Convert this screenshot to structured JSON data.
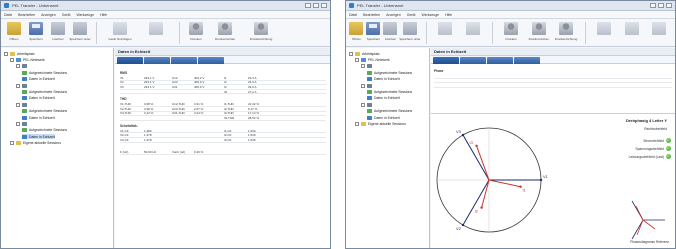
{
  "left": {
    "title": "PEL Transfer - Unbenannt",
    "menu": [
      "Datei",
      "Bearbeiten",
      "Anzeigen",
      "Gerät",
      "Werkzeuge",
      "Hilfe"
    ],
    "toolbar": [
      {
        "label": "Öffnen",
        "icon": "folder-icon"
      },
      {
        "label": "Speichern",
        "icon": "save-icon"
      },
      {
        "label": "Löschen",
        "icon": "delete-icon"
      },
      {
        "label": "Speichern unter",
        "icon": "save-as-icon"
      },
      {
        "label": "Gerät hinzufügen",
        "icon": "add-device-icon"
      },
      {
        "label": "",
        "icon": "device-icon"
      },
      {
        "label": "Drucken",
        "icon": "print-icon"
      },
      {
        "label": "Druckvorschau",
        "icon": "print-preview-icon"
      },
      {
        "label": "Druckeinrichtung",
        "icon": "print-setup-icon"
      }
    ],
    "tree": [
      {
        "label": "Arbeitsplatz",
        "icon": "folder-icon",
        "level": 0,
        "selected": false
      },
      {
        "label": "PEL-Netzwerk",
        "icon": "network-icon",
        "level": 1,
        "selected": false
      },
      {
        "label": "",
        "icon": "device-icon",
        "level": 2,
        "selected": false
      },
      {
        "label": "Aufgezeichnete Sessions",
        "icon": "session-icon",
        "level": 3,
        "selected": false
      },
      {
        "label": "Daten in Echtzeit",
        "icon": "live-icon",
        "level": 3,
        "selected": false
      },
      {
        "label": "",
        "icon": "device-icon",
        "level": 2,
        "selected": false
      },
      {
        "label": "Aufgezeichnete Sessions",
        "icon": "session-icon",
        "level": 3,
        "selected": false
      },
      {
        "label": "Daten in Echtzeit",
        "icon": "live-icon",
        "level": 3,
        "selected": false
      },
      {
        "label": "",
        "icon": "device-icon",
        "level": 2,
        "selected": false
      },
      {
        "label": "Aufgezeichnete Sessions",
        "icon": "session-icon",
        "level": 3,
        "selected": false
      },
      {
        "label": "Daten in Echtzeit",
        "icon": "live-icon",
        "level": 3,
        "selected": false
      },
      {
        "label": "",
        "icon": "device-icon",
        "level": 2,
        "selected": false
      },
      {
        "label": "Aufgezeichnete Sessions",
        "icon": "session-icon",
        "level": 3,
        "selected": false
      },
      {
        "label": "Daten in Echtzeit",
        "icon": "live-icon",
        "level": 3,
        "selected": true
      },
      {
        "label": "Eigene aktuelle Sessions",
        "icon": "folder-icon",
        "level": 1,
        "selected": false
      }
    ],
    "main_title": "Daten in Echtzeit",
    "tabs": [
      "",
      "",
      "",
      ""
    ],
    "sections": [
      {
        "name": "RMS",
        "rows": [
          [
            "V1",
            "233,1 V",
            "U12",
            "404,2 V",
            "I1",
            "23,3 A"
          ],
          [
            "V2",
            "233,1 V",
            "U23",
            "406,0 V",
            "I2",
            "23,3 A"
          ],
          [
            "V3",
            "233,1 V",
            "U31",
            "405,9 V",
            "I3",
            "33,0 A"
          ],
          [
            "",
            "",
            "",
            "",
            "IN",
            "27,2 A"
          ]
        ]
      },
      {
        "name": "THD",
        "rows": [
          [
            "V1-THD",
            "3,08 %",
            "U12-THD",
            "3,31 %",
            "I1-THD",
            "21,32 %"
          ],
          [
            "V2-THD",
            "3,38 %",
            "U23-THD",
            "2,07 %",
            "I2-THD",
            "6,17 %"
          ],
          [
            "V3-THD",
            "3,12 %",
            "U31-THD",
            "3,24 %",
            "I3-THD",
            "17,14 %"
          ],
          [
            "",
            "",
            "",
            "",
            "IN-THD",
            "28,52 %"
          ]
        ]
      },
      {
        "name": "Scheitelfak.",
        "rows": [
          [
            "V1-CF",
            "1,383",
            "",
            "",
            "I1-CF",
            "1,534"
          ],
          [
            "V2-CF",
            "1,378",
            "",
            "",
            "I2-CF",
            "1,533"
          ],
          [
            "V3-CF",
            "1,378",
            "",
            "",
            "I3-CF",
            "1,535"
          ]
        ]
      },
      {
        "name": "",
        "rows": [
          [
            "F (Hz)",
            "50,00 Hz",
            "Vunb (u2)",
            "0,40 %",
            "",
            ""
          ]
        ]
      }
    ]
  },
  "right": {
    "title": "PEL Transfer - Unbenannt",
    "menu": [
      "Datei",
      "Bearbeiten",
      "Anzeigen",
      "Gerät",
      "Werkzeuge",
      "Hilfe"
    ],
    "toolbar": [
      {
        "label": "Öffnen",
        "icon": "folder-icon"
      },
      {
        "label": "Speichern",
        "icon": "save-icon"
      },
      {
        "label": "Löschen",
        "icon": "delete-icon"
      },
      {
        "label": "Speichern unter",
        "icon": "save-as-icon"
      },
      {
        "label": "",
        "icon": "add-device-icon"
      },
      {
        "label": "",
        "icon": "device-icon"
      },
      {
        "label": "Drucken",
        "icon": "print-icon"
      },
      {
        "label": "Druckvorschau",
        "icon": "print-preview-icon"
      },
      {
        "label": "Druckeinrichtung",
        "icon": "print-setup-icon"
      },
      {
        "label": "",
        "icon": "gray-icon"
      },
      {
        "label": "",
        "icon": "gray-icon"
      },
      {
        "label": "",
        "icon": "gray-icon"
      }
    ],
    "tree": [
      {
        "label": "Arbeitsplatz",
        "icon": "folder-icon",
        "level": 0,
        "selected": false
      },
      {
        "label": "PEL-Netzwerk",
        "icon": "network-icon",
        "level": 1,
        "selected": false
      },
      {
        "label": "",
        "icon": "device-icon",
        "level": 2,
        "selected": false
      },
      {
        "label": "Aufgezeichnete Sessions",
        "icon": "session-icon",
        "level": 3,
        "selected": false
      },
      {
        "label": "Daten in Echtzeit",
        "icon": "live-icon",
        "level": 3,
        "selected": false
      },
      {
        "label": "",
        "icon": "device-icon",
        "level": 2,
        "selected": false
      },
      {
        "label": "Aufgezeichnete Sessions",
        "icon": "session-icon",
        "level": 3,
        "selected": false
      },
      {
        "label": "Daten in Echtzeit",
        "icon": "live-icon",
        "level": 3,
        "selected": false
      },
      {
        "label": "",
        "icon": "device-icon",
        "level": 2,
        "selected": false
      },
      {
        "label": "Aufgezeichnete Sessions",
        "icon": "session-icon",
        "level": 3,
        "selected": false
      },
      {
        "label": "Daten in Echtzeit",
        "icon": "live-icon",
        "level": 3,
        "selected": false
      },
      {
        "label": "Eigene aktuelle Sessions",
        "icon": "folder-icon",
        "level": 1,
        "selected": false
      }
    ],
    "main_title": "Daten in Echtzeit",
    "tabs": [
      "",
      "",
      "",
      ""
    ],
    "section_name": "Phase",
    "rows": [
      [
        "",
        "",
        "",
        "",
        "",
        "",
        "",
        ""
      ],
      [
        "",
        "",
        "",
        "",
        "",
        "",
        "",
        ""
      ],
      [
        "",
        "",
        "",
        "",
        "",
        "",
        "",
        ""
      ]
    ],
    "panel_title": "Drehphasig 4 Leiter Y",
    "panel_sub": "Rechtsdrehfeld",
    "status": [
      {
        "label": "Stromdrehfeld",
        "color": "#2f9a2a"
      },
      {
        "label": "Spannungsdrehfeld",
        "color": "#2f9a2a"
      },
      {
        "label": "Leistungsdrehfeld (Last)",
        "color": "#2f9a2a"
      }
    ],
    "phasors": [
      {
        "label": "V1",
        "angle_deg": 0,
        "magnitude": 1.0,
        "color": "#1f2a6b"
      },
      {
        "label": "V2",
        "angle_deg": -120,
        "magnitude": 1.0,
        "color": "#1f2a6b"
      },
      {
        "label": "V3",
        "angle_deg": 120,
        "magnitude": 1.0,
        "color": "#1f2a6b"
      },
      {
        "label": "I1",
        "angle_deg": -12,
        "magnitude": 0.62,
        "color": "#c8342b"
      },
      {
        "label": "I2",
        "angle_deg": -105,
        "magnitude": 0.55,
        "color": "#c8342b"
      },
      {
        "label": "I3",
        "angle_deg": 110,
        "magnitude": 0.7,
        "color": "#c8342b"
      }
    ],
    "reference_label": "Phasendiagramm Referenz",
    "colors": {
      "voltage": "#1f2a6b",
      "current": "#c8342b"
    }
  }
}
